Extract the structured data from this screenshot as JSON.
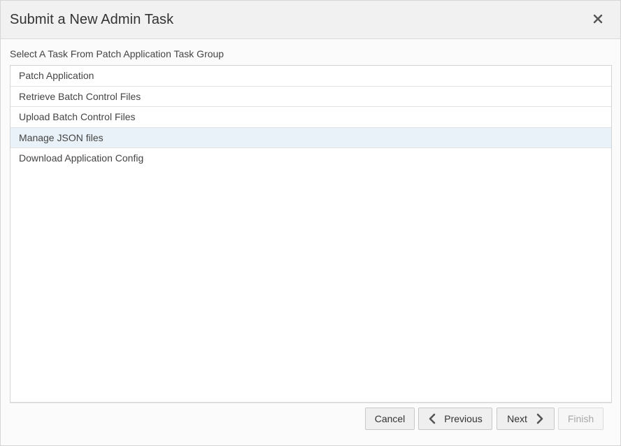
{
  "dialog": {
    "title": "Submit a New Admin Task",
    "close_icon": "close-icon"
  },
  "task_group": {
    "label": "Select A Task From Patch Application Task Group",
    "tasks": [
      {
        "label": "Patch Application",
        "selected": false
      },
      {
        "label": "Retrieve Batch Control Files",
        "selected": false
      },
      {
        "label": "Upload Batch Control Files",
        "selected": false
      },
      {
        "label": "Manage JSON files",
        "selected": true
      },
      {
        "label": "Download Application Config",
        "selected": false
      }
    ]
  },
  "footer": {
    "cancel_label": "Cancel",
    "previous_label": "Previous",
    "previous_icon": "chevron-left-icon",
    "next_label": "Next",
    "next_icon": "chevron-right-icon",
    "finish_label": "Finish",
    "finish_disabled": true
  },
  "colors": {
    "header_bg": "#f1f1f1",
    "selected_row": "#e8f2f8",
    "disabled_text": "#a8a8a8"
  }
}
